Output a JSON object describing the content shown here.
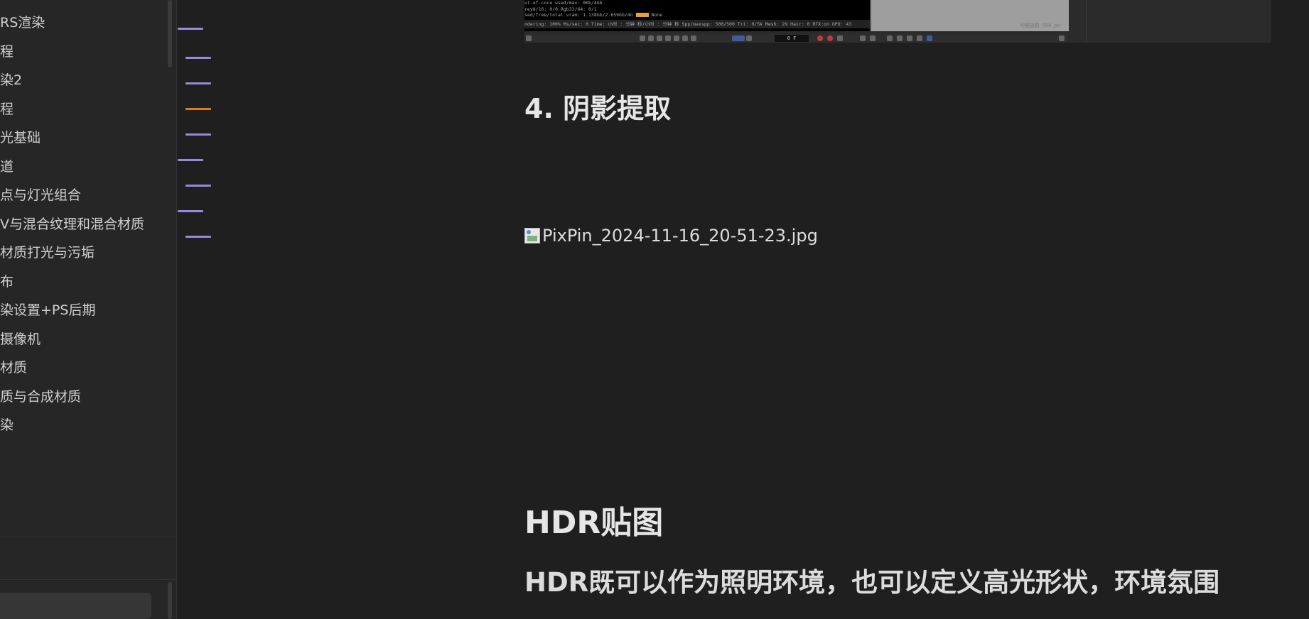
{
  "sidebar": {
    "items": [
      {
        "label": "RS渲染"
      },
      {
        "label": "程"
      },
      {
        "label": "染2"
      },
      {
        "label": "程"
      },
      {
        "label": "光基础"
      },
      {
        "label": "道"
      },
      {
        "label": "点与灯光组合"
      },
      {
        "label": "V与混合纹理和混合材质"
      },
      {
        "label": "材质打光与污垢"
      },
      {
        "label": "布"
      },
      {
        "label": "染设置+PS后期"
      },
      {
        "label": "摄像机"
      },
      {
        "label": "材质"
      },
      {
        "label": "质与合成材质"
      },
      {
        "label": "染"
      }
    ]
  },
  "outline_marks": [
    {
      "color": "#9b86e0"
    },
    {
      "color": "#9b86e0"
    },
    {
      "color": "#9b86e0"
    },
    {
      "color": "#e07a1f"
    },
    {
      "color": "#9b86e0"
    },
    {
      "color": "#9b86e0"
    },
    {
      "color": "#9b86e0"
    },
    {
      "color": "#9b86e0"
    },
    {
      "color": "#9b86e0"
    }
  ],
  "embedded_screenshot": {
    "stats_lines": [
      "ut-of-core used/max: 0Kb/4Gb",
      "rey8/16: 0/0          Rgb32/64: 0/1",
      "sed/free/total vram: 1.138Gb/2.659Gb/4G"
    ],
    "statusbar": "ndering: 100%   Ms/sec: 0   Time: 小时 : 分钟  秒/小时 : 分钟  秒   Spp/maxspp: 500/500   Tri: 0/5k   Mesh: 29   Hair: 0   RTX:on   GPU: 43",
    "none_label": "None",
    "frame_value": "0 F",
    "dim_label": "可缩放图  558 px"
  },
  "content": {
    "heading4": "4. 阴影提取",
    "image_alt": "PixPin_2024-11-16_20-51-23.jpg",
    "heading2": "HDR贴图",
    "paragraph": "HDR既可以作为照明环境，也可以定义高光形状，环境氛围"
  }
}
